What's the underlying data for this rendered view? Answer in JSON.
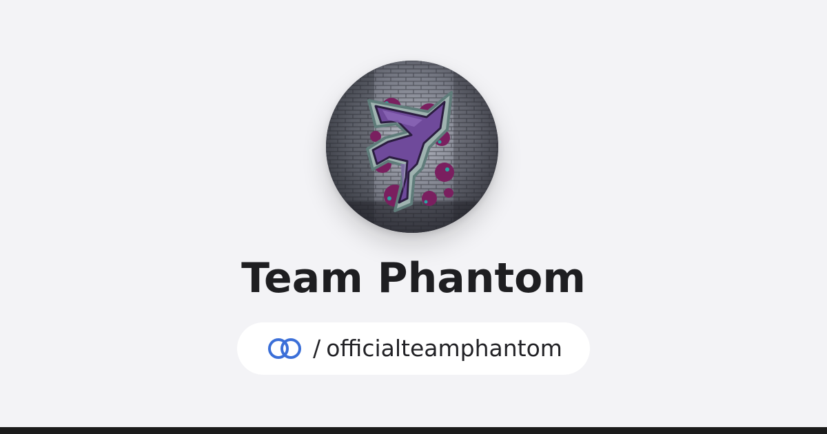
{
  "profile": {
    "name": "Team Phantom",
    "avatar_icon": "team-phantom-graffiti-logo"
  },
  "handle": {
    "brand_icon": "linked-rings-icon",
    "brand_color": "#3b6fd8",
    "separator": "/",
    "username": "officialteamphantom"
  },
  "colors": {
    "background": "#f3f3f6",
    "pill": "#ffffff",
    "text": "#1e1e21",
    "bottom_bar": "#1b1b1b",
    "logo_purple": "#6f4a9b",
    "logo_teal": "#2ba5a0",
    "logo_magenta": "#7a1f5f"
  }
}
